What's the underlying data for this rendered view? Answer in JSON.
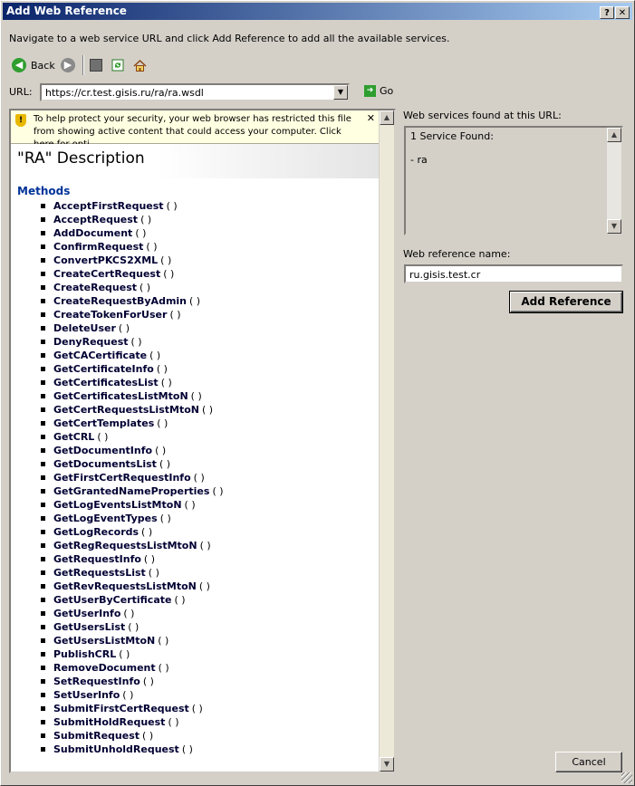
{
  "window": {
    "title": "Add Web Reference",
    "help_btn": "?",
    "close_btn": "✕"
  },
  "instructions": "Navigate to a web service URL and click Add Reference to add all the available services.",
  "toolbar": {
    "back_label": "Back",
    "go_label": "Go"
  },
  "url": {
    "label": "URL:",
    "value": "https://cr.test.gisis.ru/ra/ra.wsdl"
  },
  "browser": {
    "infobar": "To help protect your security, your web browser has restricted this file from showing active content that could access your computer. Click here for opti...",
    "heading": "\"RA\" Description",
    "methods_title": "Methods",
    "methods": [
      "AcceptFirstRequest",
      "AcceptRequest",
      "AddDocument",
      "ConfirmRequest",
      "ConvertPKCS2XML",
      "CreateCertRequest",
      "CreateRequest",
      "CreateRequestByAdmin",
      "CreateTokenForUser",
      "DeleteUser",
      "DenyRequest",
      "GetCACertificate",
      "GetCertificateInfo",
      "GetCertificatesList",
      "GetCertificatesListMtoN",
      "GetCertRequestsListMtoN",
      "GetCertTemplates",
      "GetCRL",
      "GetDocumentInfo",
      "GetDocumentsList",
      "GetFirstCertRequestInfo",
      "GetGrantedNameProperties",
      "GetLogEventsListMtoN",
      "GetLogEventTypes",
      "GetLogRecords",
      "GetRegRequestsListMtoN",
      "GetRequestInfo",
      "GetRequestsList",
      "GetRevRequestsListMtoN",
      "GetUserByCertificate",
      "GetUserInfo",
      "GetUsersList",
      "GetUsersListMtoN",
      "PublishCRL",
      "RemoveDocument",
      "SetRequestInfo",
      "SetUserInfo",
      "SubmitFirstCertRequest",
      "SubmitHoldRequest",
      "SubmitRequest",
      "SubmitUnholdRequest"
    ],
    "method_suffix": "( )"
  },
  "services": {
    "label": "Web services found at this URL:",
    "found": "1 Service Found:",
    "item": "- ra"
  },
  "reference": {
    "label": "Web reference name:",
    "value": "ru.gisis.test.cr"
  },
  "buttons": {
    "add_reference": "Add Reference",
    "cancel": "Cancel"
  }
}
